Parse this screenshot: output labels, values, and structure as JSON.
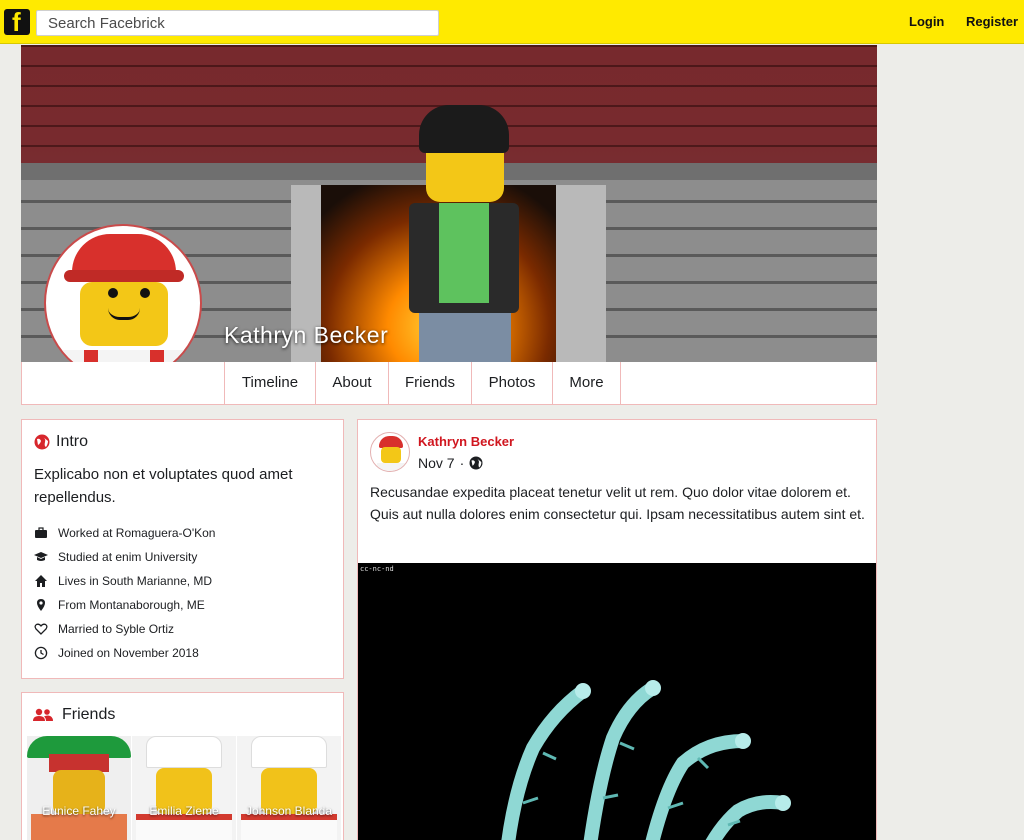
{
  "topbar": {
    "logo_letter": "f",
    "search_placeholder": "Search Facebrick",
    "login_label": "Login",
    "register_label": "Register",
    "accent_color": "#ffea00"
  },
  "profile": {
    "name": "Kathryn Becker",
    "tabs": [
      {
        "label": "Timeline"
      },
      {
        "label": "About"
      },
      {
        "label": "Friends"
      },
      {
        "label": "Photos"
      },
      {
        "label": "More"
      }
    ]
  },
  "intro": {
    "title": "Intro",
    "title_icon": "globe-icon",
    "bio": "Explicabo non et voluptates quod amet repellendus.",
    "details": [
      {
        "icon": "briefcase-icon",
        "text": "Worked at Romaguera-O'Kon"
      },
      {
        "icon": "graduation-cap-icon",
        "text": "Studied at enim University"
      },
      {
        "icon": "home-icon",
        "text": "Lives in South Marianne, MD"
      },
      {
        "icon": "map-pin-icon",
        "text": "From Montanaborough, ME"
      },
      {
        "icon": "heart-icon",
        "text": "Married to Syble Ortiz"
      },
      {
        "icon": "clock-icon",
        "text": "Joined on November 2018"
      }
    ]
  },
  "friends": {
    "title": "Friends",
    "title_icon": "users-icon",
    "items": [
      {
        "name": "Eunice Fahey"
      },
      {
        "name": "Emilia Zieme"
      },
      {
        "name": "Johnson Blanda"
      }
    ]
  },
  "post": {
    "author": "Kathryn Becker",
    "date": "Nov 7",
    "separator": "·",
    "visibility_icon": "globe-icon",
    "text": "Recusandae expedita placeat tenetur velit ut rem. Quo dolor vitae dolorem et. Quis aut nulla dolores enim consectetur qui. Ipsam necessitatibus autem sint et.",
    "image_license": "cc-nc-nd"
  }
}
